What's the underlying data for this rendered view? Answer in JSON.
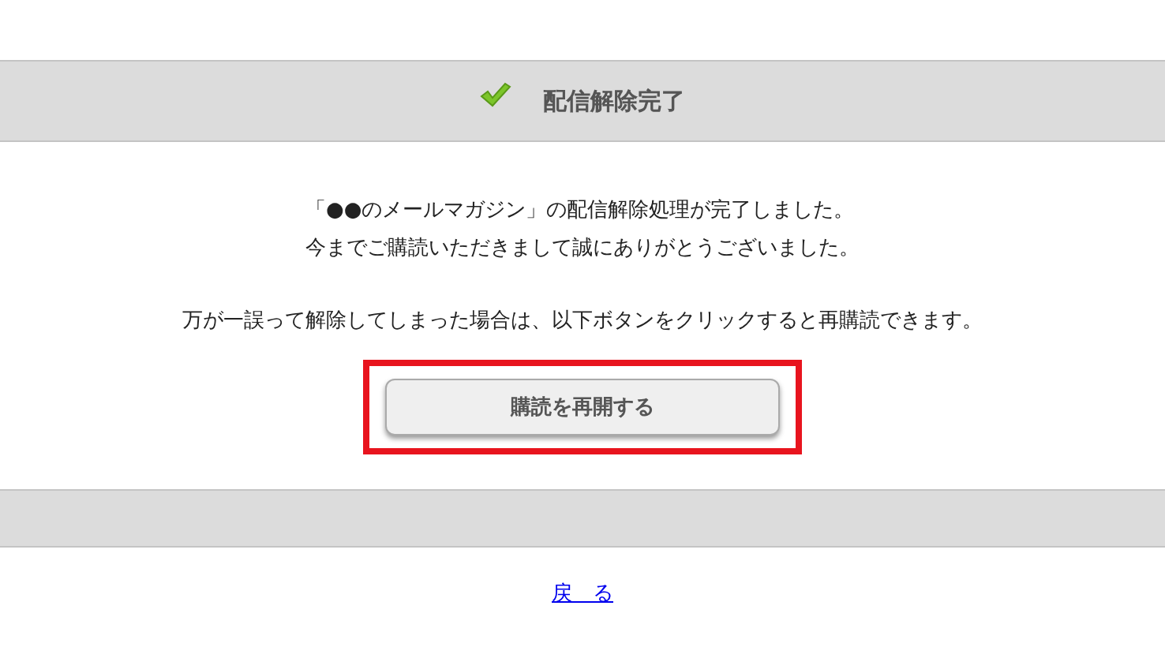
{
  "header": {
    "title": "配信解除完了"
  },
  "message": {
    "lines": [
      "「●●のメールマガジン」の配信解除処理が完了しました。",
      "今までご購読いただきまして誠にありがとうございました。"
    ],
    "note": "万が一誤って解除してしまった場合は、以下ボタンをクリックすると再購読できます。"
  },
  "resubscribe_button": {
    "label": "購読を再開する",
    "highlighted": true
  },
  "back_link": "戻　る"
}
